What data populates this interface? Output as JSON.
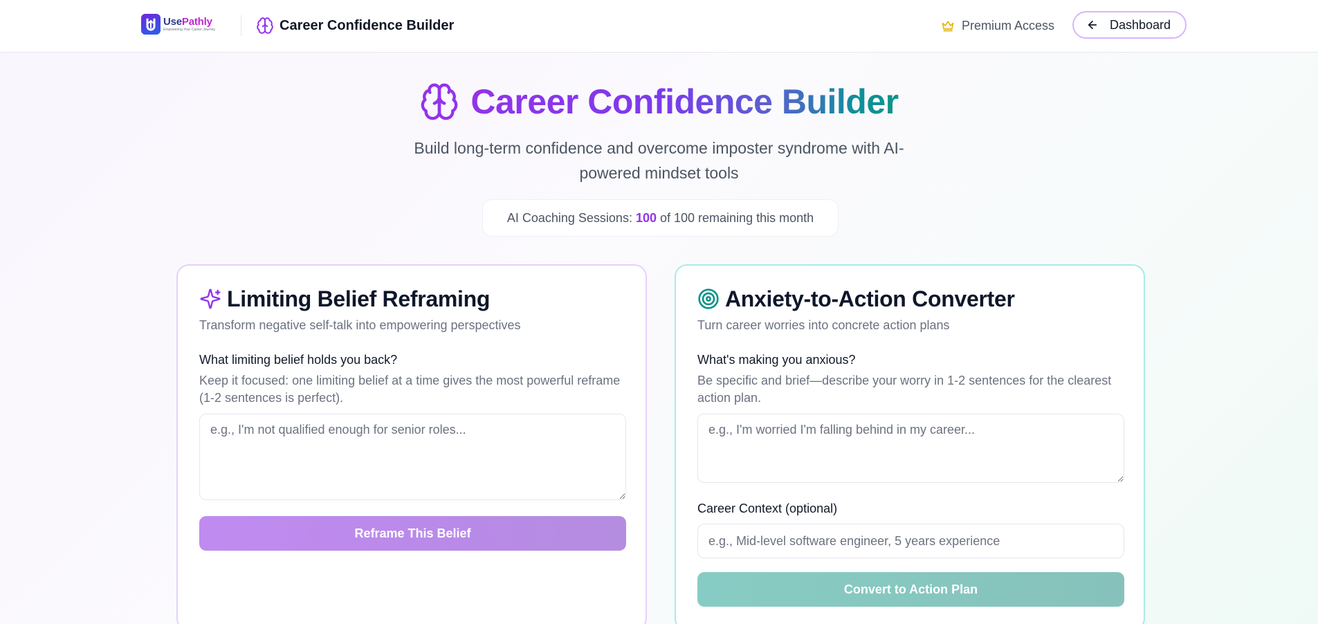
{
  "header": {
    "logo": {
      "name_part1": "Use",
      "name_part2": "Pathly",
      "tagline": "Empowering Your Career Journey"
    },
    "title": "Career Confidence Builder",
    "premium_label": "Premium Access",
    "dashboard_label": "Dashboard"
  },
  "hero": {
    "title": "Career Confidence Builder",
    "subtitle": "Build long-term confidence and overcome imposter syndrome with AI-powered mindset tools",
    "sessions": {
      "prefix": "AI Coaching Sessions:",
      "remaining": "100",
      "suffix": "of 100 remaining this month"
    }
  },
  "cards": {
    "belief": {
      "icon": "sparkles-icon",
      "title": "Limiting Belief Reframing",
      "description": "Transform negative self-talk into empowering perspectives",
      "field_label": "What limiting belief holds you back?",
      "field_help": "Keep it focused: one limiting belief at a time gives the most powerful reframe (1-2 sentences is perfect).",
      "placeholder": "e.g., I'm not qualified enough for senior roles...",
      "value": "",
      "button": "Reframe This Belief"
    },
    "anxiety": {
      "icon": "target-icon",
      "title": "Anxiety-to-Action Converter",
      "description": "Turn career worries into concrete action plans",
      "field_label": "What's making you anxious?",
      "field_help": "Be specific and brief—describe your worry in 1-2 sentences for the clearest action plan.",
      "placeholder": "e.g., I'm worried I'm falling behind in my career...",
      "value": "",
      "context_label": "Career Context (optional)",
      "context_placeholder": "e.g., Mid-level software engineer, 5 years experience",
      "context_value": "",
      "button": "Convert to Action Plan"
    }
  },
  "colors": {
    "purple": "#9333ea",
    "teal": "#0d9488",
    "premium_crown": "#eab308",
    "left_border": "#e4d2fb",
    "right_border": "#a7ece4"
  }
}
